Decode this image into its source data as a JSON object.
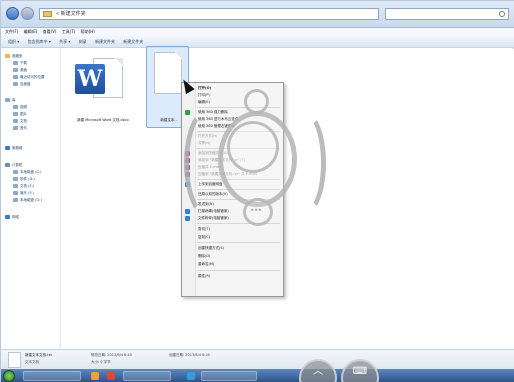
{
  "window": {
    "breadcrumb": "« 新建文件夹",
    "menubar": [
      "文件(F)",
      "编辑(E)",
      "查看(V)",
      "工具(T)",
      "帮助(H)"
    ],
    "toolbar": [
      "组织 ▾",
      "包含到库中 ▾",
      "共享 ▾",
      "刻录",
      "新建文件夹",
      "新建文件夹"
    ]
  },
  "sidebar": {
    "items": [
      {
        "label": "收藏夹",
        "icon": "star-icon"
      },
      {
        "label": "下载",
        "icon": "download-icon"
      },
      {
        "label": "桌面",
        "icon": "desktop-icon"
      },
      {
        "label": "最近访问的位置",
        "icon": "recent-icon"
      },
      {
        "label": "百度盘",
        "icon": "cloud-icon"
      },
      {
        "label": "库",
        "icon": "library-icon"
      },
      {
        "label": "视频",
        "icon": "video-icon"
      },
      {
        "label": "图片",
        "icon": "picture-icon"
      },
      {
        "label": "文档",
        "icon": "document-icon"
      },
      {
        "label": "音乐",
        "icon": "music-icon"
      },
      {
        "label": "家庭组",
        "icon": "homegroup-icon"
      },
      {
        "label": "计算机",
        "icon": "computer-icon"
      },
      {
        "label": "本地磁盘 (C:)",
        "icon": "drive-icon"
      },
      {
        "label": "软件 (D:)",
        "icon": "drive-icon"
      },
      {
        "label": "文档 (E:)",
        "icon": "drive-icon"
      },
      {
        "label": "娱乐 (F:)",
        "icon": "drive-icon"
      },
      {
        "label": "本地磁盘 (G:)",
        "icon": "drive-icon"
      },
      {
        "label": "网络",
        "icon": "network-icon"
      }
    ]
  },
  "files": [
    {
      "name": "新建 Microsoft Word 文档.docx",
      "icon": "word-document-icon",
      "badge": "W"
    },
    {
      "name": "新建文本...",
      "icon": "text-document-icon"
    }
  ],
  "context_menu": {
    "items": [
      {
        "label": "打开(O)",
        "style": "bold"
      },
      {
        "label": "打印(P)"
      },
      {
        "label": "编辑(E)"
      },
      {
        "label": "使用 360 强力删除"
      },
      {
        "label": "使用 360 进行木马云查杀"
      },
      {
        "label": "使用 360 管理右键菜单"
      },
      {
        "label": "打开方式(H)",
        "style": "dim"
      },
      {
        "label": "共享(H)",
        "style": "dim"
      },
      {
        "label": "添加到压缩文件(A)...",
        "style": "dim"
      },
      {
        "label": "添加到 \"新建文本文档.rar\"(T)",
        "style": "dim"
      },
      {
        "label": "压缩并 E-mail...",
        "style": "dim"
      },
      {
        "label": "压缩到 \"新建文本文档.rar\" 并 E-mail",
        "style": "dim"
      },
      {
        "label": "上传到百度网盘"
      },
      {
        "label": "还原以前的版本(V)"
      },
      {
        "label": "发送到(N)"
      },
      {
        "label": "扫描病毒(电脑管家)"
      },
      {
        "label": "文件粉碎(电脑管家)"
      },
      {
        "label": "剪切(T)"
      },
      {
        "label": "复制(C)"
      },
      {
        "label": "创建快捷方式(S)"
      },
      {
        "label": "删除(D)"
      },
      {
        "label": "重命名(M)"
      },
      {
        "label": "属性(R)"
      }
    ]
  },
  "details": {
    "name": "新建文本文档.txt",
    "type": "文本文档",
    "modified": "修改日期: 2013/6/4 6:45",
    "size": "大小: 0 字节",
    "created": "创建日期: 2013/6/4 6:45"
  },
  "overlay": {
    "dots": "•••",
    "up_icon": "︿",
    "keyboard_icon": "⌨"
  }
}
